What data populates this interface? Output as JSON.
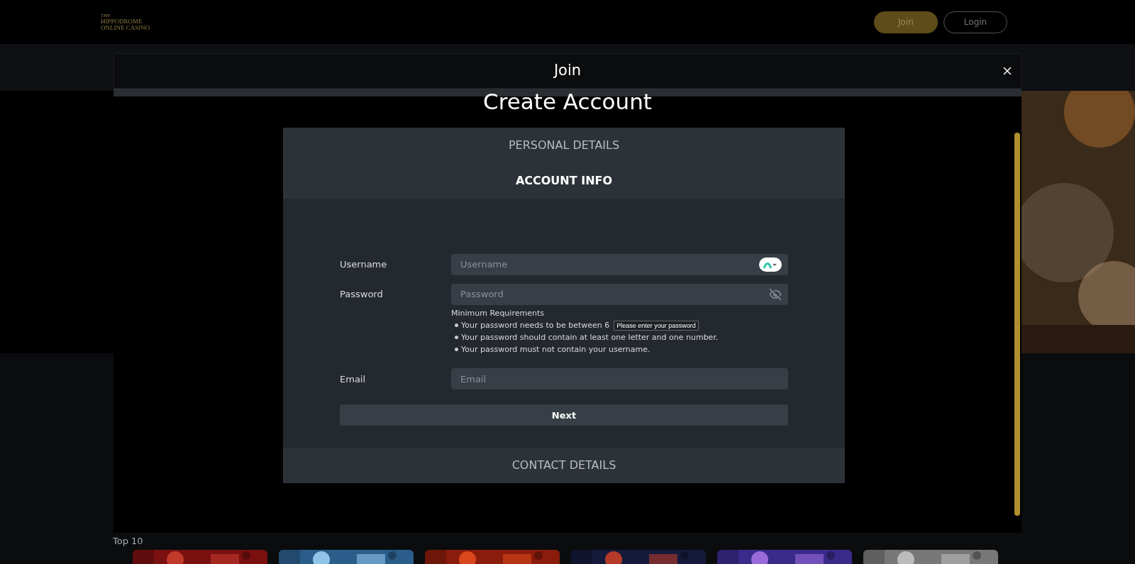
{
  "header": {
    "logo": {
      "line_1": "THE",
      "line_2": "HIPPODROME",
      "line_3": "ONLINE CASINO"
    },
    "buttons": [
      {
        "label": "Join",
        "kind": "primary"
      },
      {
        "label": "Login",
        "kind": "outline"
      }
    ]
  },
  "section": {
    "title": "Top 10"
  },
  "modal": {
    "title": "Join",
    "heading": "Create Account",
    "steps": [
      {
        "label": "PERSONAL DETAILS",
        "selected": false
      },
      {
        "label": "ACCOUNT INFO",
        "selected": true
      }
    ],
    "fields": [
      {
        "label": "Username",
        "placeholder": "Username",
        "kind": "username"
      },
      {
        "label": "Password",
        "placeholder": "Password",
        "kind": "password"
      }
    ],
    "requirements": {
      "title": "Minimum Requirements",
      "items": [
        "Your password needs to be between 6",
        "Your password should contain at least one letter and one number.",
        "Your password must not contain your username."
      ],
      "tooltip": "Please enter your password"
    },
    "email": {
      "label": "Email",
      "placeholder": "Email"
    },
    "next_button": "Next",
    "last_step": {
      "label": "CONTACT DETAILS",
      "selected": false
    }
  }
}
